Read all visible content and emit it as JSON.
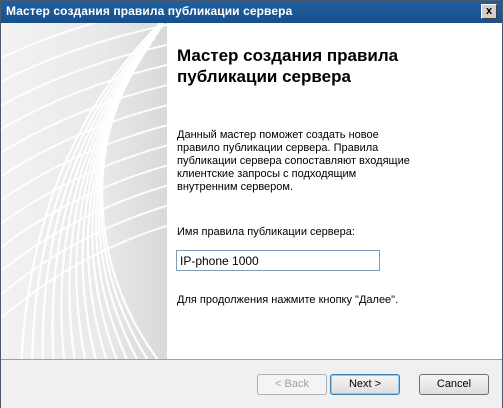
{
  "window": {
    "title": "Мастер создания правила публикации сервера",
    "close_glyph": "x"
  },
  "content": {
    "heading": "Мастер создания правила публикации сервера",
    "description": "Данный мастер поможет создать новое правило публикации сервера. Правила публикации сервера сопоставляют входящие клиентские запросы с подходящим внутренним сервером.",
    "field_label": "Имя правила публикации сервера:",
    "field_value": "IP-phone 1000",
    "footer_note": "Для продолжения нажмите кнопку \"Далее\"."
  },
  "buttons": {
    "back": "< Back",
    "next": "Next >",
    "cancel": "Cancel"
  },
  "colors": {
    "titlebar": "#1f5f9e",
    "banner_lines": "#ffffff"
  }
}
